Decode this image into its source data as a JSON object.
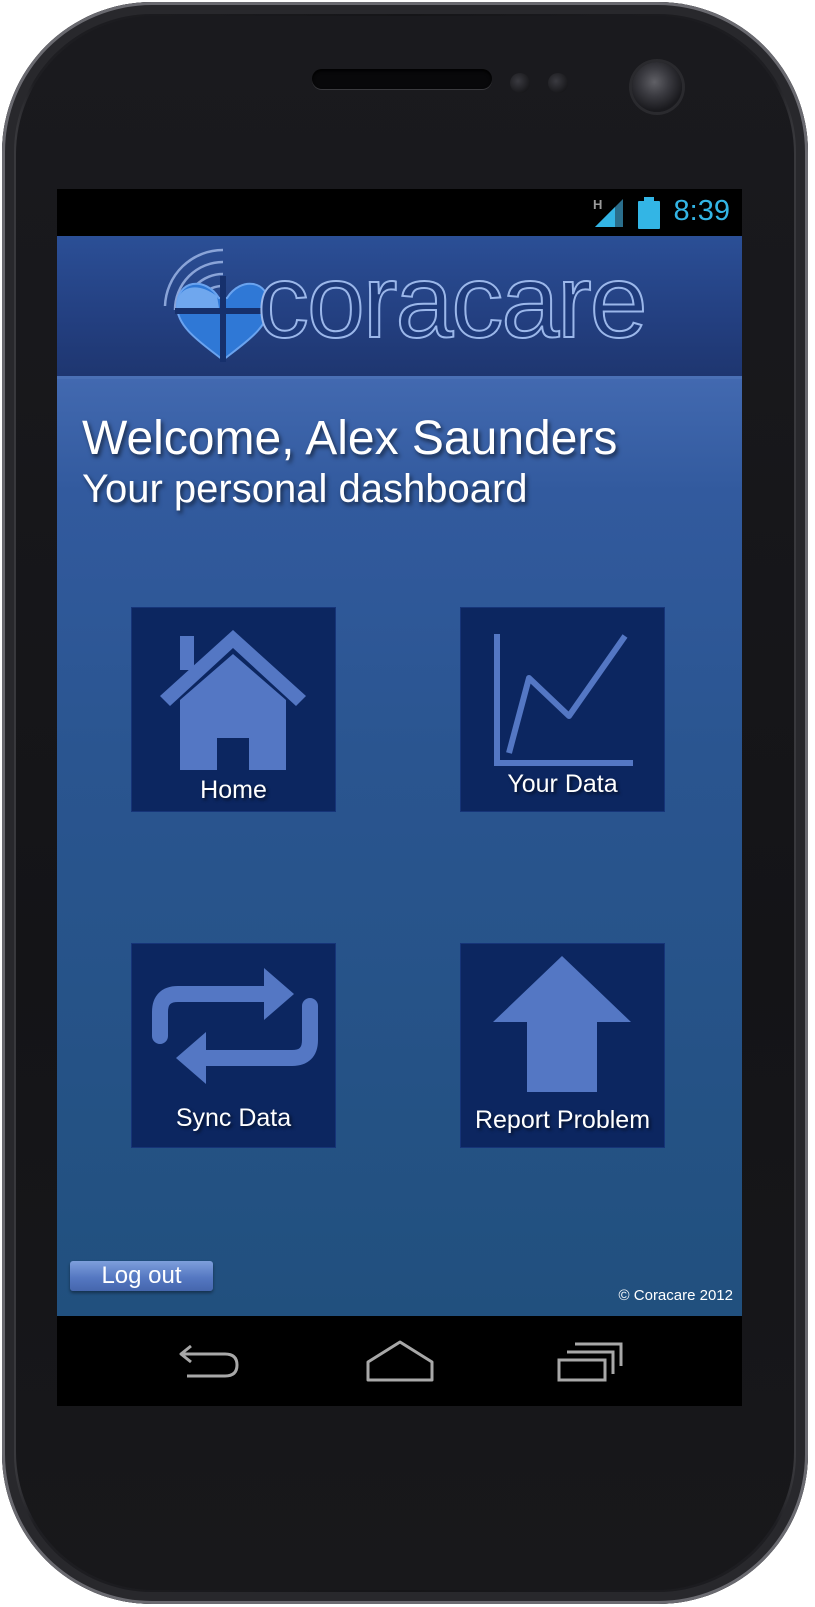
{
  "statusbar": {
    "time": "8:39",
    "network_type": "H",
    "icons": [
      "signal-icon",
      "battery-icon"
    ],
    "time_color": "#33b5e5"
  },
  "header": {
    "logo_text": "coracare",
    "logo_icon": "heart-wave-icon"
  },
  "main": {
    "welcome": "Welcome, Alex Saunders",
    "subtitle": "Your personal dashboard",
    "tiles": [
      {
        "label": "Home",
        "icon": "home-icon"
      },
      {
        "label": "Your Data",
        "icon": "line-chart-icon"
      },
      {
        "label": "Sync Data",
        "icon": "sync-icon"
      },
      {
        "label": "Report Problem",
        "icon": "up-arrow-icon"
      }
    ]
  },
  "footer": {
    "logout_label": "Log out",
    "copyright": "© Coracare 2012"
  },
  "navbar": {
    "buttons": [
      "back-icon",
      "home-nav-icon",
      "recent-apps-icon"
    ]
  },
  "colors": {
    "accent": "#33b5e5",
    "header_bg": "#233f80",
    "tile_bg": "#0c2660",
    "tile_icon": "#5477c4"
  }
}
